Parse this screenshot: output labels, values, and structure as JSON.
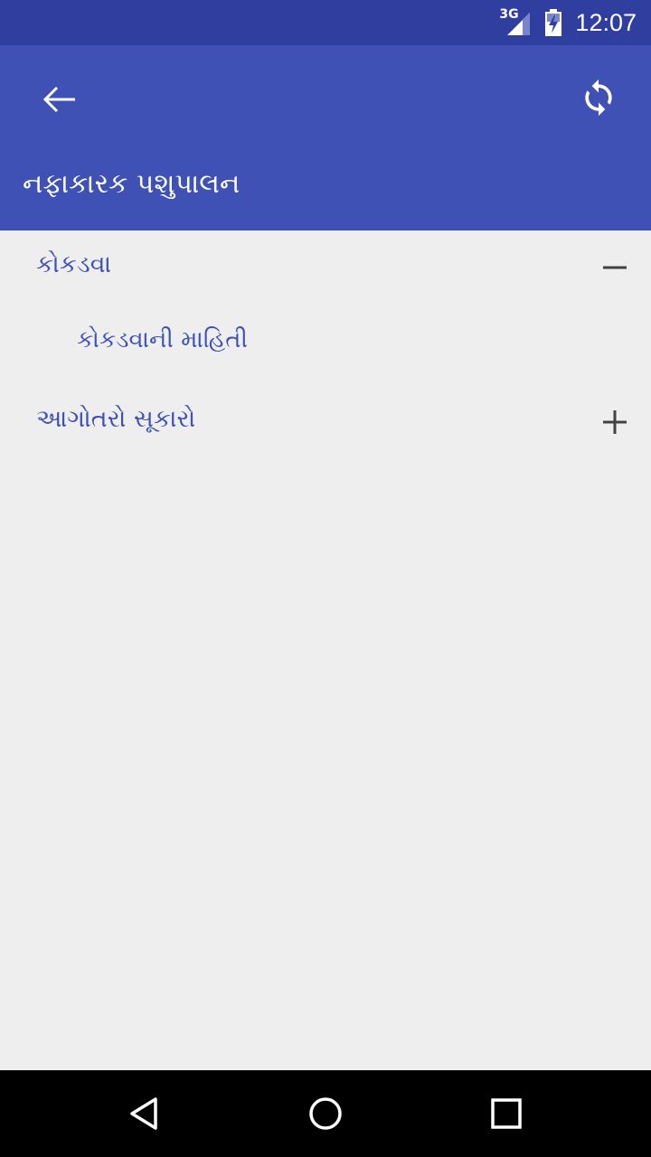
{
  "status_bar": {
    "network": "3G",
    "time": "12:07"
  },
  "toolbar": {
    "title": "નફાકારક પશુપાલન",
    "back_icon": "arrow-back-icon",
    "sync_icon": "sync-icon"
  },
  "tree": {
    "items": [
      {
        "label": "કોકડવા",
        "expanded": true,
        "toggle_icon": "minus-icon"
      },
      {
        "label": "કોકડવાની માહિતી",
        "level": 1
      },
      {
        "label": "આગોતરો સૂકારો",
        "expanded": false,
        "toggle_icon": "plus-icon"
      }
    ]
  },
  "colors": {
    "status_bar": "#303f9f",
    "app_bar": "#3f51b5",
    "item_text": "#3f51b5",
    "background": "#eeeeee"
  },
  "nav_bar": {
    "buttons": [
      "back-triangle-icon",
      "home-circle-icon",
      "recents-square-icon"
    ]
  }
}
